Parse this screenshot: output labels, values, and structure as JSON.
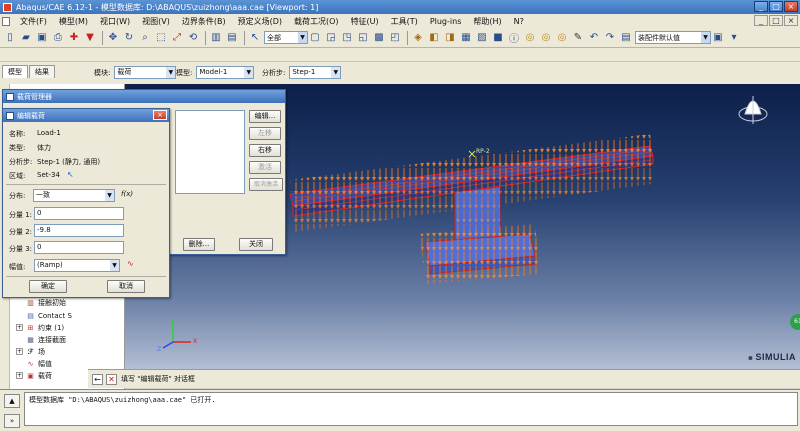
{
  "window": {
    "title": "Abaqus/CAE 6.12-1 - 模型数据库: D:\\ABAQUS\\zuizhong\\aaa.cae [Viewport: 1]",
    "buttons": [
      "_",
      "□",
      "×"
    ]
  },
  "menubar": {
    "items": [
      "文件(F)",
      "模型(M)",
      "视口(W)",
      "视图(V)",
      "边界条件(B)",
      "预定义场(D)",
      "载荷工况(O)",
      "特征(U)",
      "工具(T)",
      "Plug-ins",
      "帮助(H)",
      "N?"
    ],
    "window_controls": [
      "_",
      "□",
      "×"
    ]
  },
  "toolbar": {
    "filter_select": "全部",
    "assembly_select": "装配件默认值"
  },
  "context": {
    "tabs": [
      "模型",
      "结果"
    ],
    "module_label": "模块:",
    "module_value": "载荷",
    "model_label": "模型:",
    "model_value": "Model-1",
    "step_label": "分析步:",
    "step_value": "Step-1"
  },
  "tree": {
    "items": [
      {
        "icon": "▥",
        "label": "接触初始"
      },
      {
        "icon": "▤",
        "label": "Contact S"
      },
      {
        "icon": "⊞",
        "label": "约束 (1)"
      },
      {
        "icon": "▦",
        "label": "连接截面"
      },
      {
        "icon": "ℱ",
        "label": "场"
      },
      {
        "icon": "∿",
        "label": "幅值"
      },
      {
        "icon": "▣",
        "label": "载荷"
      }
    ]
  },
  "load_manager": {
    "title": "载荷管理器",
    "buttons": {
      "edit": "编辑...",
      "left": "左移",
      "right": "右移",
      "activate": "激活",
      "deactivate": "取消激活",
      "delete": "删除...",
      "close": "关闭"
    }
  },
  "edit_load": {
    "title": "编辑载荷",
    "name_label": "名称:",
    "name_value": "Load-1",
    "type_label": "类型:",
    "type_value": "体力",
    "step_label": "分析步:",
    "step_value": "Step-1 (静力, 通用)",
    "region_label": "区域:",
    "region_value": "Set-34",
    "distribution_label": "分布:",
    "distribution_value": "一致",
    "fx_label": "f(x)",
    "comp1_label": "分量 1:",
    "comp1_value": "0",
    "comp2_label": "分量 2:",
    "comp2_value": "-9.8",
    "comp3_label": "分量 3:",
    "comp3_value": "0",
    "amplitude_label": "幅值:",
    "amplitude_value": "(Ramp)",
    "ok": "确定",
    "cancel": "取消"
  },
  "viewport": {
    "rp_label": "RP-2",
    "brand": "SIMULIA",
    "badge": "61",
    "triad_labels": [
      "Y",
      "Z",
      "X"
    ]
  },
  "prompt": {
    "text": "填写 \"编辑载荷\" 对话框"
  },
  "message": {
    "text": "模型数据库 \"D:\\ABAQUS\\zuizhong\\aaa.cae\" 已打开."
  }
}
